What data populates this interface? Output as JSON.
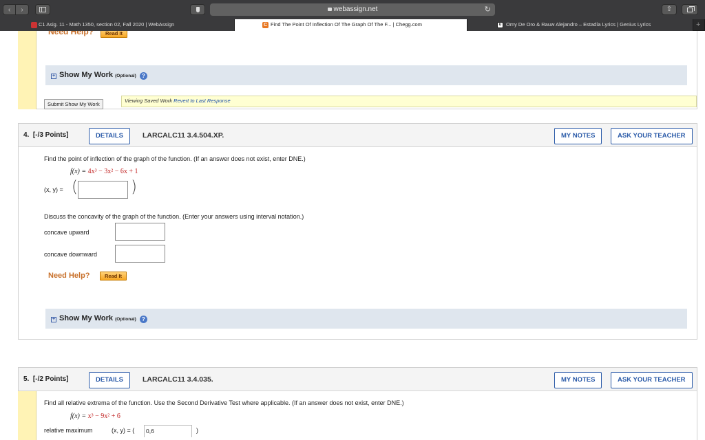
{
  "browser": {
    "url": "webassign.net",
    "nav_back": "‹",
    "nav_forward": "›",
    "tabs": [
      {
        "title": "C1 Asig. 11 - Math 1350, section 02, Fall 2020 | WebAssign"
      },
      {
        "title": "Find The Point Of Inflection Of The Graph Of The F... | Chegg.com",
        "favicon": "C"
      },
      {
        "title": "Omy De Oro & Rauw Alejandro – Estadía Lyrics | Genius Lyrics",
        "favicon": "ʊ"
      }
    ],
    "new_tab": "+"
  },
  "prev_question": {
    "need_help": "Need Help?",
    "read_it": "Read It",
    "show_work": "Show My Work",
    "optional": "(Optional)",
    "submit_show_work": "Submit Show My Work",
    "viewing_saved_work": "Viewing Saved Work",
    "revert": "Revert to Last Response"
  },
  "q4": {
    "number": "4.",
    "points": "[-/3 Points]",
    "details": "DETAILS",
    "code": "LARCALC11 3.4.504.XP.",
    "my_notes": "MY NOTES",
    "ask_teacher": "ASK YOUR TEACHER",
    "prompt": "Find the point of inflection of the graph of the function. (If an answer does not exist, enter DNE.)",
    "function_lhs": "f(x) = ",
    "function_rhs": "4x³ − 3x² − 6x + 1",
    "xy_label": "(x, y) = ",
    "xy_value": "",
    "discuss": "Discuss the concavity of the graph of the function. (Enter your answers using interval notation.)",
    "concave_up_label": "concave upward",
    "concave_up_value": "",
    "concave_down_label": "concave downward",
    "concave_down_value": "",
    "need_help": "Need Help?",
    "read_it": "Read It",
    "show_work": "Show My Work",
    "optional": "(Optional)"
  },
  "q5": {
    "number": "5.",
    "points": "[-/2 Points]",
    "details": "DETAILS",
    "code": "LARCALC11 3.4.035.",
    "my_notes": "MY NOTES",
    "ask_teacher": "ASK YOUR TEACHER",
    "prompt": "Find all relative extrema of the function. Use the Second Derivative Test where applicable. (If an answer does not exist, enter DNE.)",
    "function_lhs": "f(x) = ",
    "function_rhs": "x³ − 9x² + 6",
    "rel_max_label": "relative maximum",
    "xy_label": "(x, y) = (",
    "rel_max_value": "0,6",
    "close_paren": ")"
  },
  "colors": {
    "accent_blue": "#2a5aa8",
    "help_orange": "#c8702a",
    "math_red": "#c02020",
    "yellow_bar": "#fff3b5"
  }
}
